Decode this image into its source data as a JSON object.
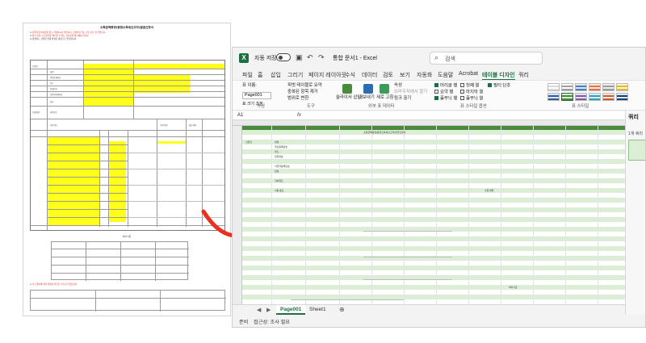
{
  "document": {
    "title": "소득금액증명(종합소득세신고자)발급신청서",
    "notes_red": [
      "※ 뒤쪽의 유의사항을 읽고 작성하시기 바랍니다. 신청인이 적는 란은 굵은 선 안입니다.",
      "※ 발급 신청 시 본인임을 확인할 수 있는 신분증을 제시해야 합니다."
    ],
    "notes_black": [
      "※ 증명서는 신청일 현재 확정된 내용으로 발급됩니다."
    ],
    "labels": [
      "신청인",
      "성명",
      "주민등록번호",
      "주소",
      "전화번호",
      "사업자등록번호",
      "상호",
      "신청내용",
      "귀속연도",
      "사용 용도",
      "수령 방법",
      "발급 매수"
    ],
    "section_title": "처리기준",
    "footer_red": "※ 이 신청서에 의한 증명서 발급은 수수료가 없습니다."
  },
  "excel": {
    "autosave_label": "자동 저장",
    "filename": "통합 문서1 - Excel",
    "search_placeholder": "검색",
    "tabs": [
      "파일",
      "홈",
      "삽입",
      "그리기",
      "페이지 레이아웃",
      "수식",
      "데이터",
      "검토",
      "보기",
      "자동화",
      "도움말",
      "Acrobat",
      "테이블 디자인",
      "쿼리"
    ],
    "active_tab": "테이블 디자인",
    "ribbon": {
      "table_name_label": "표 이름:",
      "table_name_value": "Page001",
      "resize_table": "표 크기 조정",
      "pivot_summary": "피벗 테이블로 요약",
      "remove_duplicates": "중복된 항목 제거",
      "convert_to_range": "범위로 변환",
      "insert_slicer": "슬라이서 삽입",
      "export": "내보내기",
      "refresh": "새로 고침",
      "properties": "속성",
      "open_in_browser": "브라우저에서 열기",
      "unlink": "링크 끊기",
      "opt_header_row": "머리글 행",
      "opt_first_column": "첫째 열",
      "opt_filter_button": "필터 단추",
      "opt_total_row": "요약 행",
      "opt_last_column": "마지막 열",
      "opt_banded_rows": "줄무늬 행",
      "opt_banded_columns": "줄무늬 열",
      "group_properties": "속성",
      "group_tools": "도구",
      "group_external": "외부 표 데이터",
      "group_style_options": "표 스타일 옵션",
      "group_styles": "표 스타일"
    },
    "cell_ref": "A1",
    "fx": "fx",
    "task_pane": {
      "title": "쿼리",
      "subtitle": "1개 쿼리"
    },
    "sheets": [
      "Page001",
      "Sheet1"
    ],
    "active_sheet": "Page001",
    "status": {
      "ready": "준비",
      "accessibility": "접근성: 조사 필요"
    },
    "table_cells": [
      "소득금액증명(종합소득세신고자)발급신청서",
      "신청인",
      "성명",
      "주민등록번호",
      "주소",
      "전화번호",
      "사업자등록번호",
      "상호",
      "귀속연도",
      "사용 용도",
      "수령 방법",
      "처리기준"
    ]
  },
  "colors": {
    "excel_green": "#1d6f42",
    "doc_yellow": "#ffff1a",
    "arrow_red": "#e8311f",
    "table_header": "#4a8a3c",
    "table_band": "#dcefd6"
  }
}
